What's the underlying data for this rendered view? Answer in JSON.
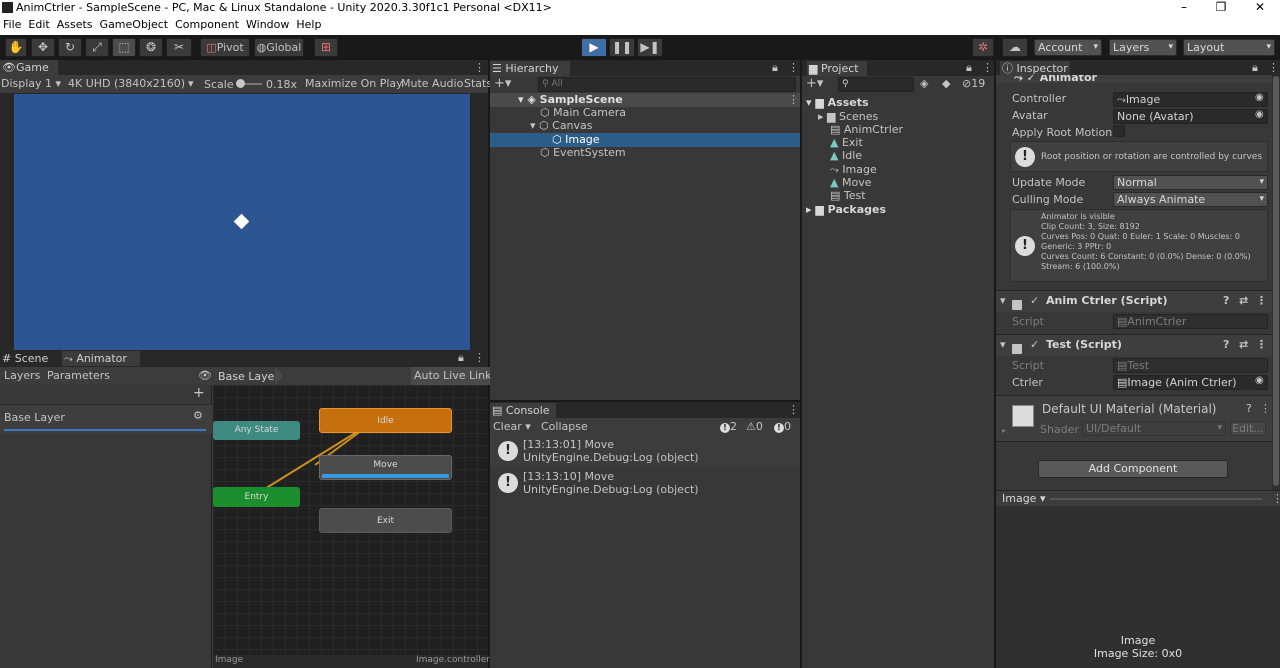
{
  "window": {
    "title": "AnimCtrler - SampleScene - PC, Mac & Linux Standalone - Unity 2020.3.30f1c1 Personal <DX11>",
    "minimize": "–",
    "maximize": "❐",
    "close": "✕"
  },
  "menu": [
    "File",
    "Edit",
    "Assets",
    "GameObject",
    "Component",
    "Window",
    "Help"
  ],
  "toolbar": {
    "pivot": "Pivot",
    "global": "Global",
    "account": "Account",
    "layers": "Layers",
    "layout": "Layout"
  },
  "game": {
    "tab": "Game",
    "display": "Display 1",
    "resolution": "4K UHD (3840x2160)",
    "scale_label": "Scale",
    "scale_value": "0.18x",
    "maximize": "Maximize On Play",
    "mute": "Mute Audio",
    "stats": "Stats",
    "bg_color": "#2d5591"
  },
  "animator": {
    "tab_scene": "Scene",
    "tab_animator": "Animator",
    "layers_tab": "Layers",
    "parameters_tab": "Parameters",
    "breadcrumb": "Base Layer",
    "auto_live_link": "Auto Live Link",
    "layer_item": "Base Layer",
    "nodes": {
      "any_state": "Any State",
      "idle": "Idle",
      "move": "Move",
      "entry": "Entry",
      "exit": "Exit"
    },
    "footer_left": "Image",
    "footer_right": "Image.controller"
  },
  "hierarchy": {
    "tab": "Hierarchy",
    "search_placeholder": "All",
    "items": [
      "SampleScene",
      "Main Camera",
      "Canvas",
      "Image",
      "EventSystem"
    ]
  },
  "console": {
    "tab": "Console",
    "clear": "Clear",
    "collapse": "Collapse",
    "count_log": "2",
    "count_warn": "0",
    "count_err": "0",
    "entries": [
      {
        "line1": "[13:13:01] Move",
        "line2": "UnityEngine.Debug:Log (object)"
      },
      {
        "line1": "[13:13:10] Move",
        "line2": "UnityEngine.Debug:Log (object)"
      }
    ]
  },
  "project": {
    "tab": "Project",
    "hidden_count": "19",
    "items": [
      "Assets",
      "Scenes",
      "AnimCtrler",
      "Exit",
      "Idle",
      "Image",
      "Move",
      "Test",
      "Packages"
    ]
  },
  "inspector": {
    "tab": "Inspector",
    "animator_header": "Animator",
    "controller_label": "Controller",
    "controller_value": "Image",
    "avatar_label": "Avatar",
    "avatar_value": "None (Avatar)",
    "apply_root_motion": "Apply Root Motion",
    "root_info": "Root position or rotation are controlled by curves",
    "update_mode_label": "Update Mode",
    "update_mode_value": "Normal",
    "culling_mode_label": "Culling Mode",
    "culling_mode_value": "Always Animate",
    "info_lines": [
      "Animator is visible",
      "Clip Count: 3, Size: 8192",
      "Curves Pos: 0 Quat: 0 Euler: 1 Scale: 0 Muscles: 0",
      "Generic: 3 PPtr: 0",
      "Curves Count: 6 Constant: 0 (0.0%) Dense: 0 (0.0%)",
      "Stream: 6 (100.0%)"
    ],
    "animctrler_header": "Anim Ctrler (Script)",
    "script_label": "Script",
    "animctrler_script": "AnimCtrler",
    "test_header": "Test (Script)",
    "test_script": "Test",
    "ctrler_label": "Ctrler",
    "ctrler_value": "Image (Anim Ctrler)",
    "material_header": "Default UI Material (Material)",
    "shader_label": "Shader",
    "shader_value": "UI/Default",
    "edit_button": "Edit...",
    "add_component": "Add Component",
    "preview_dropdown": "Image",
    "preview_name": "Image",
    "preview_size": "Image Size: 0x0"
  }
}
